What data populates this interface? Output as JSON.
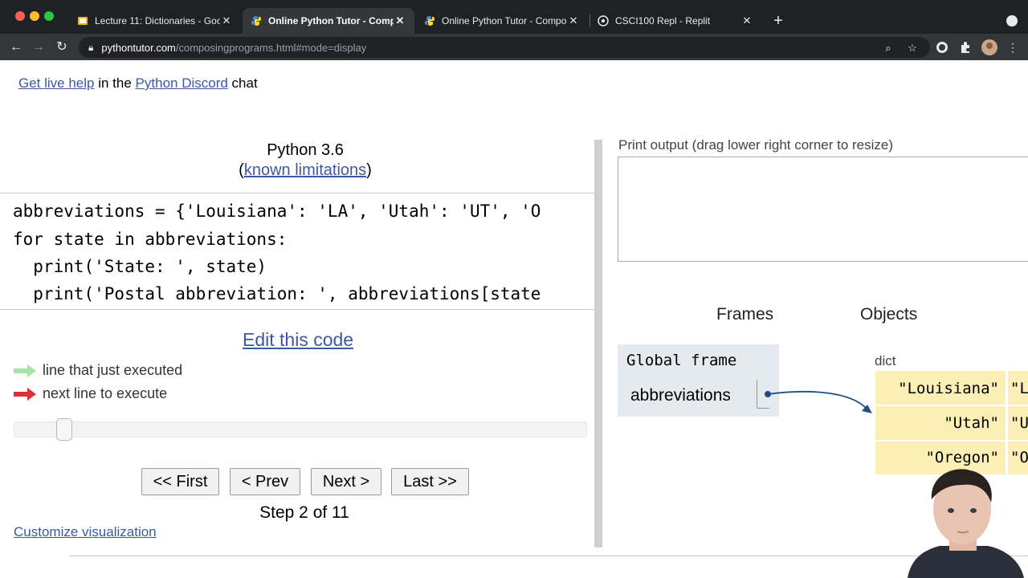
{
  "browser": {
    "tabs": [
      {
        "title": "Lecture 11: Dictionaries - Goog",
        "icon": "slides-icon",
        "color": "#f4b400"
      },
      {
        "title": "Online Python Tutor - Compos",
        "icon": "python-icon"
      },
      {
        "title": "Online Python Tutor - Compos",
        "icon": "python-icon"
      },
      {
        "title": "CSCI100 Repl - Replit",
        "icon": "replit-icon"
      }
    ],
    "url_domain": "pythontutor.com",
    "url_path": "/composingprograms.html#mode=display"
  },
  "help": {
    "link1": "Get live help",
    "middle": " in the ",
    "link2": "Python Discord",
    "end": " chat"
  },
  "header": {
    "version": "Python 3.6",
    "paren_open": "(",
    "limitations": "known limitations",
    "paren_close": ")"
  },
  "code": [
    "abbreviations = {'Louisiana': 'LA', 'Utah': 'UT', 'O",
    "for state in abbreviations:",
    "  print('State: ', state)",
    "  print('Postal abbreviation: ', abbreviations[state"
  ],
  "edit_link": "Edit this code",
  "legend": {
    "just_executed": "line that just executed",
    "next_line": "next line to execute",
    "just_executed_color": "#a6e4a6",
    "next_line_color": "#d8313a"
  },
  "slider": {
    "step": 2,
    "total": 11
  },
  "nav": {
    "first": "<< First",
    "prev": "< Prev",
    "next": "Next >",
    "last": "Last >>"
  },
  "step_text": "Step 2 of 11",
  "customize": "Customize visualization",
  "print_output_label": "Print output (drag lower right corner to resize)",
  "frames_header": "Frames",
  "objects_header": "Objects",
  "global_frame": {
    "title": "Global frame",
    "variable": "abbreviations"
  },
  "dict": {
    "label": "dict",
    "entries": [
      {
        "key": "\"Louisiana\"",
        "value": "\"L"
      },
      {
        "key": "\"Utah\"",
        "value": "\"U"
      },
      {
        "key": "\"Oregon\"",
        "value": "\"O"
      }
    ]
  }
}
